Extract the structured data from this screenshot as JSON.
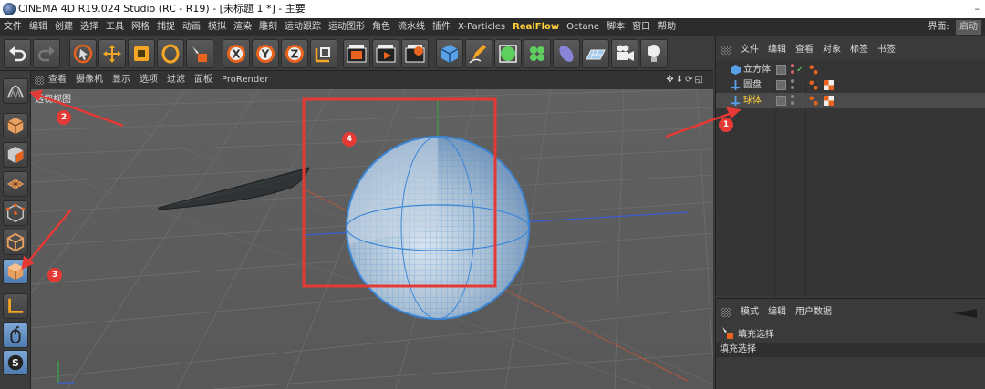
{
  "window": {
    "title": "CINEMA 4D R19.024 Studio (RC - R19) - [未标题 1 *] - 主要",
    "minimize": "–"
  },
  "menubar": {
    "items": [
      "文件",
      "编辑",
      "创建",
      "选择",
      "工具",
      "网格",
      "捕捉",
      "动画",
      "模拟",
      "渲染",
      "雕刻",
      "运动跟踪",
      "运动图形",
      "角色",
      "流水线",
      "插件",
      "X-Particles",
      "RealFlow",
      "Octane",
      "脚本",
      "窗口",
      "帮助"
    ],
    "layout_label": "界面:",
    "layout_value": "启动"
  },
  "toolbar": {
    "buttons": [
      "undo-icon",
      "redo-icon",
      "live-select-icon",
      "move-icon",
      "scale-icon",
      "rotate-icon",
      "recent-tools-icon",
      "x-axis-icon",
      "y-axis-icon",
      "z-axis-icon",
      "coordinate-system-icon",
      "render-view-icon",
      "render-picture-queue-icon",
      "render-settings-icon",
      "cube-icon",
      "pen-icon",
      "subdivision-icon",
      "cloner-icon",
      "deformer-icon",
      "floor-icon",
      "camera-icon",
      "light-icon"
    ],
    "axis_x": "X",
    "axis_y": "Y",
    "axis_z": "Z"
  },
  "viewport": {
    "menu": [
      "查看",
      "摄像机",
      "显示",
      "选项",
      "过滤",
      "面板",
      "ProRender"
    ],
    "label": "透视视图",
    "nav_icons": "✥⬇⟳◱"
  },
  "object_manager": {
    "menu": [
      "文件",
      "编辑",
      "查看",
      "对象",
      "标签",
      "书签"
    ],
    "objects": [
      {
        "name": "立方体",
        "icon": "cube",
        "selected": false,
        "highlight": false
      },
      {
        "name": "圆盘",
        "icon": "disc",
        "selected": false,
        "highlight": false
      },
      {
        "name": "球体",
        "icon": "sphere",
        "selected": true,
        "highlight": true
      }
    ],
    "check": "✓"
  },
  "attribute_manager": {
    "menu": [
      "模式",
      "编辑",
      "用户数据"
    ],
    "mode_title": "填充选择",
    "section": "填充选择"
  },
  "annotations": [
    "1",
    "2",
    "3",
    "4"
  ],
  "colors": {
    "accent_red": "#e53935",
    "highlight": "#ffd23a",
    "sphere_wire": "#5aa0e8"
  }
}
